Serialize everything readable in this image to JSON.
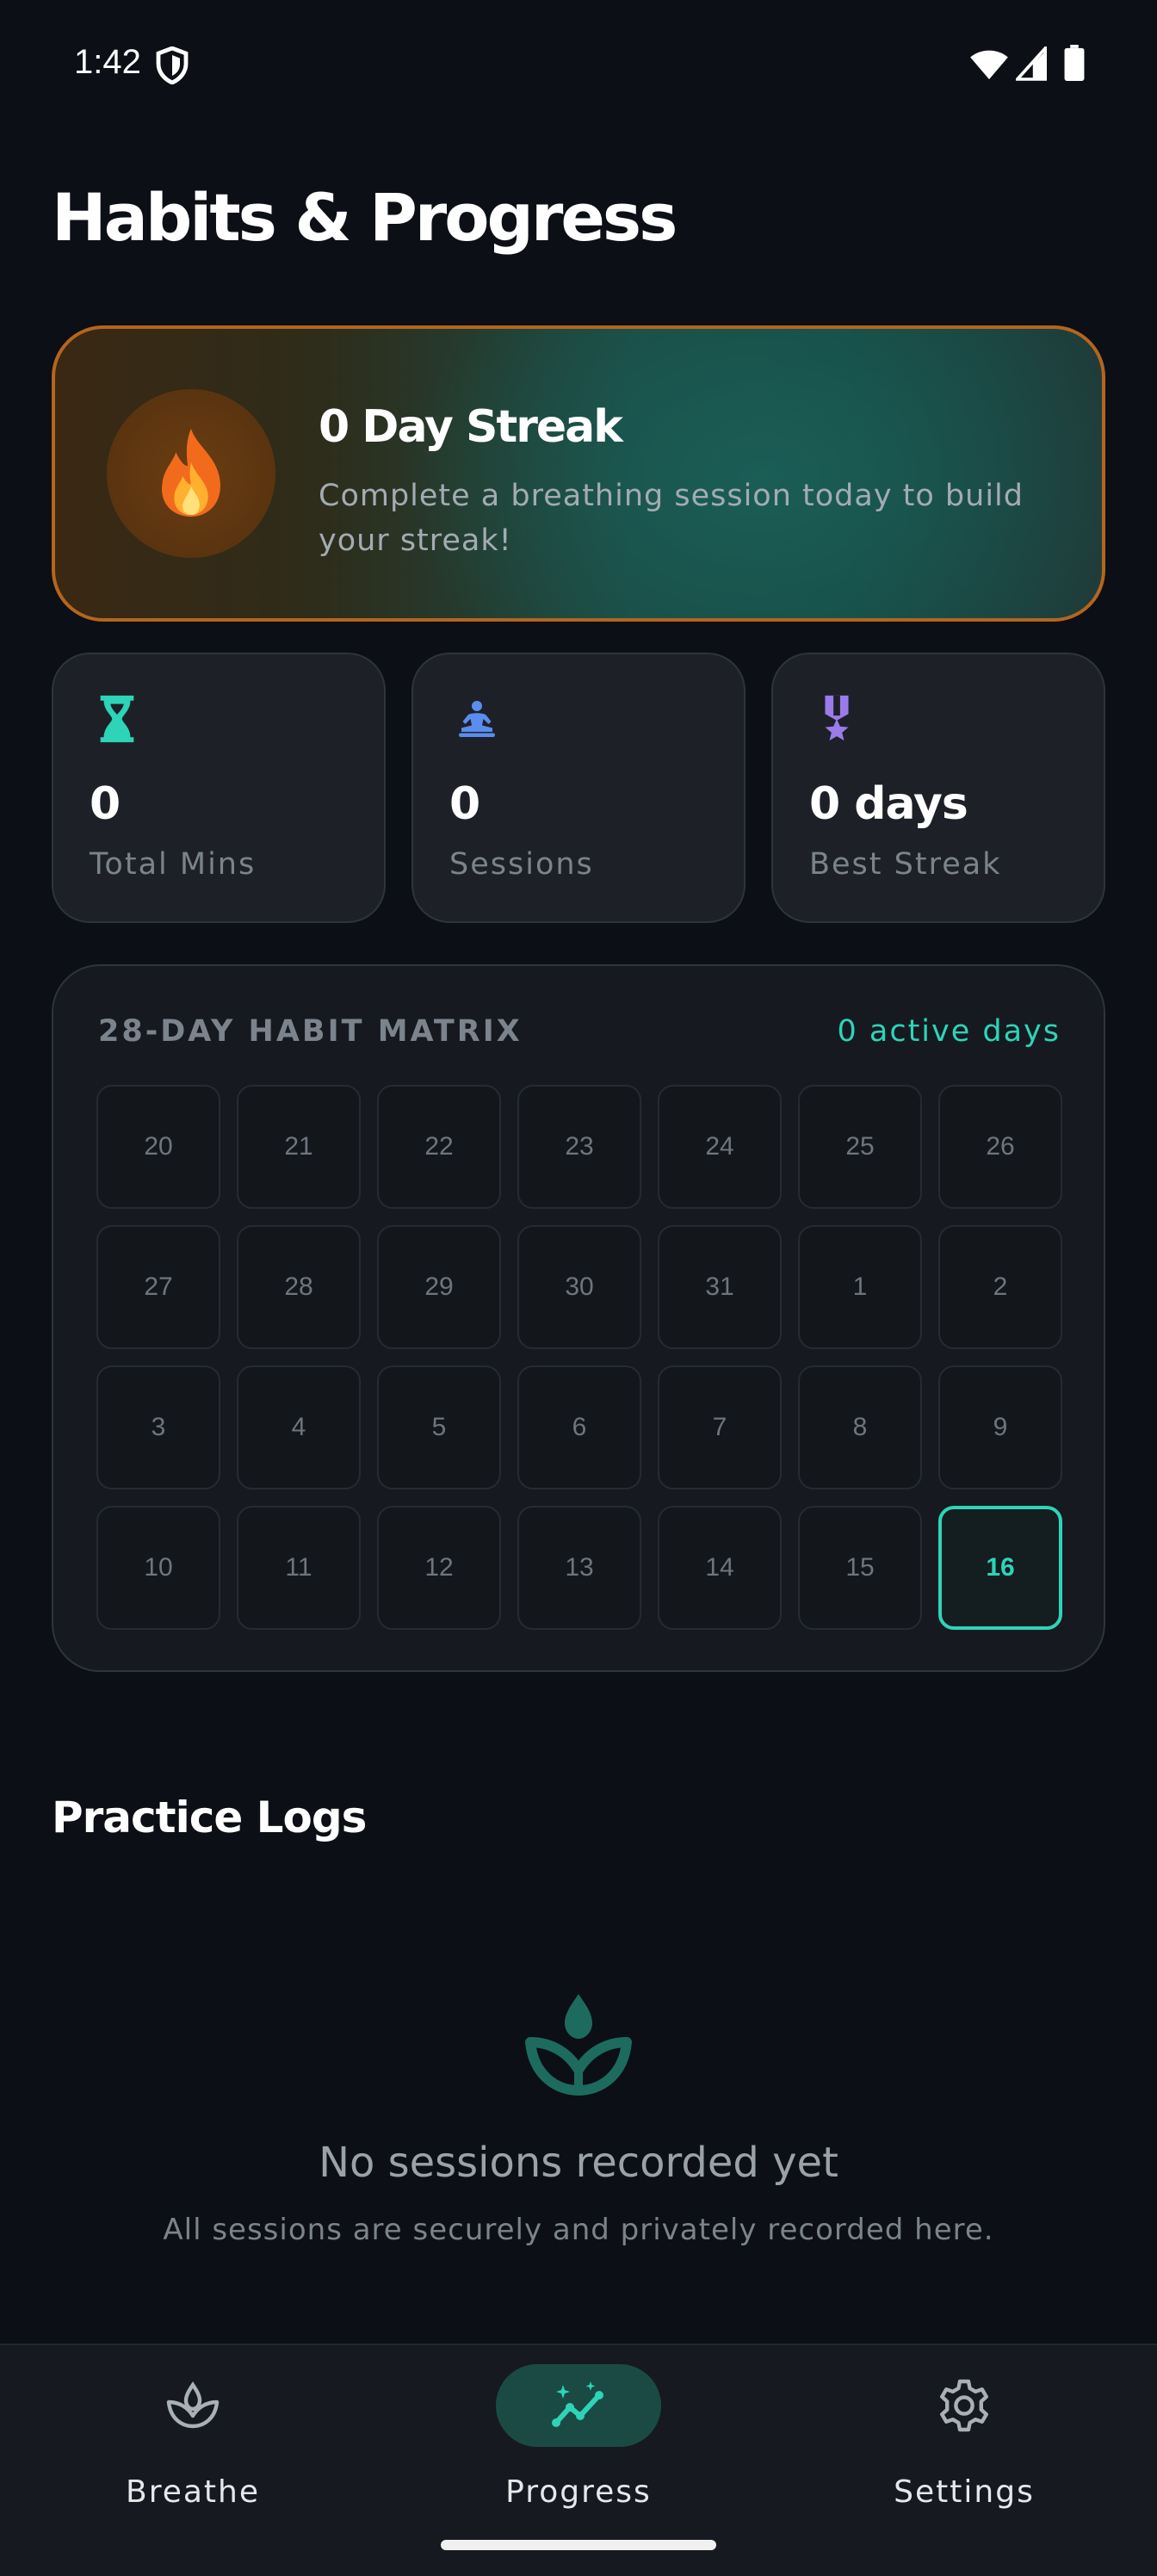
{
  "status_bar": {
    "time": "1:42"
  },
  "page": {
    "title": "Habits & Progress"
  },
  "streak": {
    "title": "0 Day Streak",
    "description": "Complete a breathing session today to build your streak!"
  },
  "stats": [
    {
      "value": "0",
      "label": "Total Mins",
      "icon": "hourglass-icon",
      "color": "#2dd4b8"
    },
    {
      "value": "0",
      "label": "Sessions",
      "icon": "meditation-icon",
      "color": "#5b8def"
    },
    {
      "value": "0 days",
      "label": "Best Streak",
      "icon": "medal-icon",
      "color": "#9b7bea"
    }
  ],
  "matrix": {
    "title": "28-DAY HABIT MATRIX",
    "active_days": "0 active days",
    "days": [
      "20",
      "21",
      "22",
      "23",
      "24",
      "25",
      "26",
      "27",
      "28",
      "29",
      "30",
      "31",
      "1",
      "2",
      "3",
      "4",
      "5",
      "6",
      "7",
      "8",
      "9",
      "10",
      "11",
      "12",
      "13",
      "14",
      "15",
      "16"
    ],
    "today": "16"
  },
  "logs": {
    "title": "Practice Logs",
    "empty_title": "No sessions recorded yet",
    "empty_desc": "All sessions are securely and privately recorded here."
  },
  "nav": {
    "items": [
      {
        "label": "Breathe",
        "icon": "lotus-icon",
        "active": false
      },
      {
        "label": "Progress",
        "icon": "trend-icon",
        "active": true
      },
      {
        "label": "Settings",
        "icon": "gear-icon",
        "active": false
      }
    ]
  },
  "colors": {
    "accent": "#2dd4b8",
    "streak_border": "#b5651d",
    "background": "#0c0f15"
  }
}
